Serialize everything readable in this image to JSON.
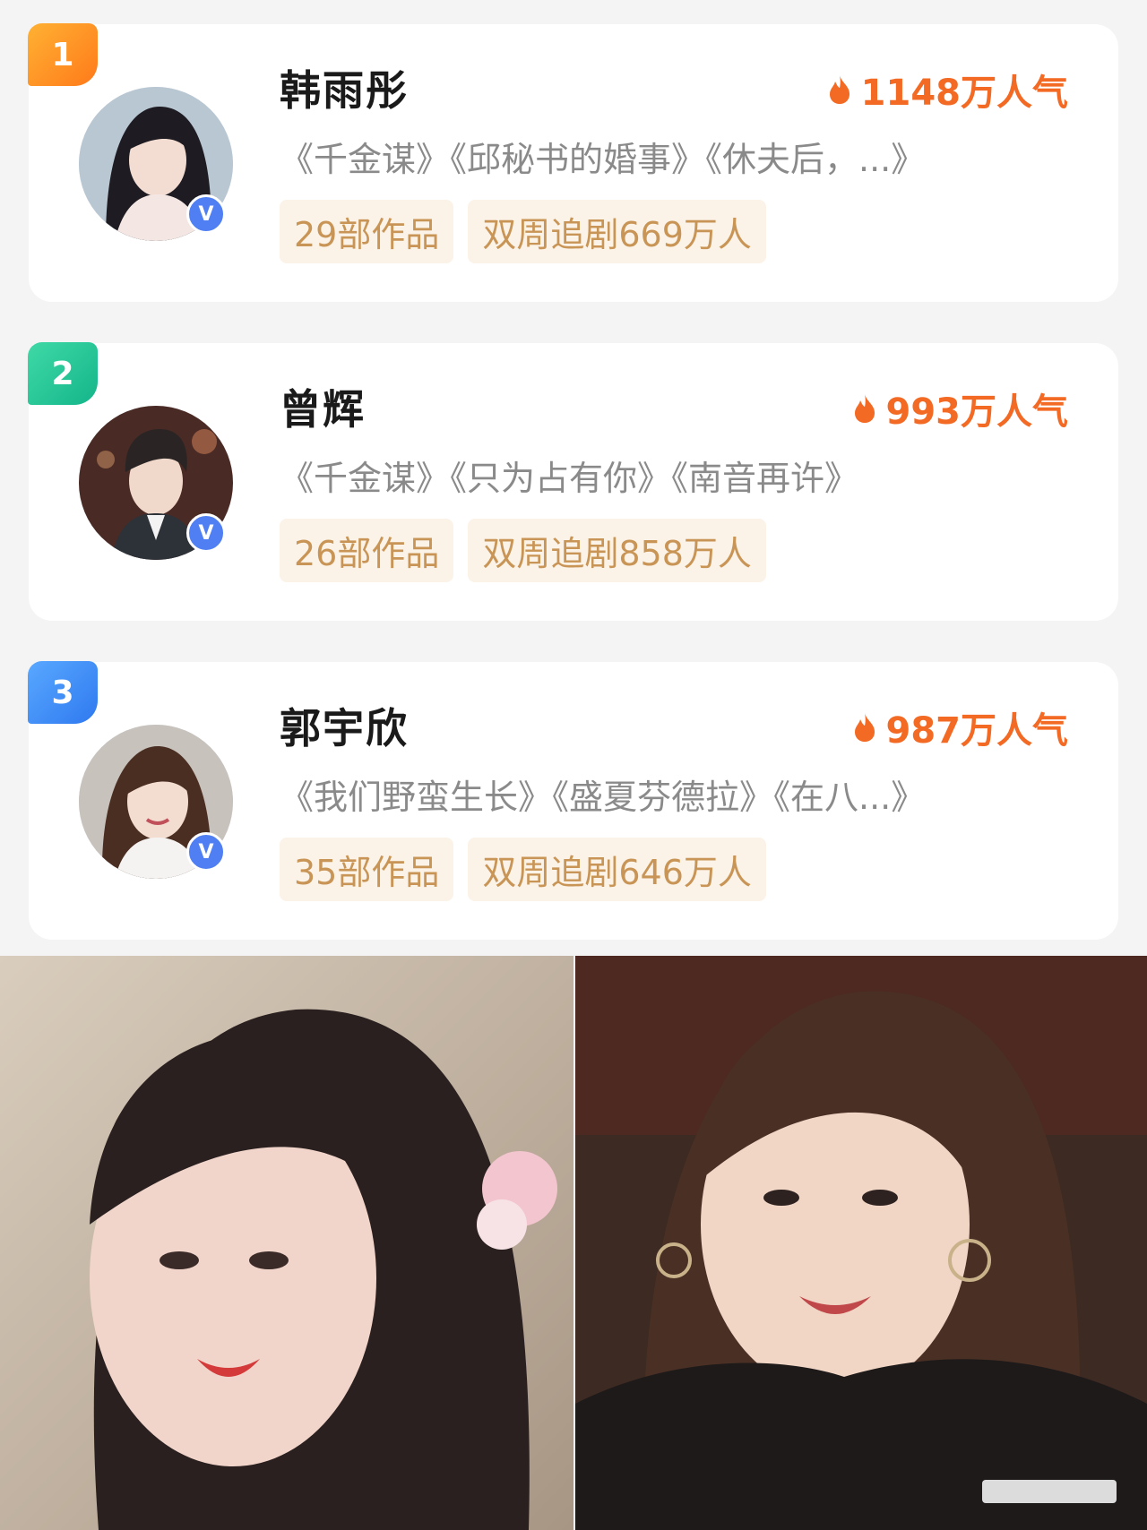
{
  "ranking": [
    {
      "rank": "1",
      "name": "韩雨彤",
      "popularity": "1148万人气",
      "works": "《千金谋》《邱秘书的婚事》《休夫后，...》",
      "works_count": "29部作品",
      "followers": "双周追剧669万人",
      "verified_badge": "V"
    },
    {
      "rank": "2",
      "name": "曾辉",
      "popularity": "993万人气",
      "works": "《千金谋》《只为占有你》《南音再许》",
      "works_count": "26部作品",
      "followers": "双周追剧858万人",
      "verified_badge": "V"
    },
    {
      "rank": "3",
      "name": "郭宇欣",
      "popularity": "987万人气",
      "works": "《我们野蛮生长》《盛夏芬德拉》《在八...》",
      "works_count": "35部作品",
      "followers": "双周追剧646万人",
      "verified_badge": "V"
    }
  ],
  "colors": {
    "rank_1": "#ff8a1f",
    "rank_2": "#1bbf90",
    "rank_3": "#3585f5",
    "popularity": "#f36a25",
    "tag_text": "#c99556",
    "tag_bg": "#fbf3e8",
    "verify_badge": "#4f7ff2"
  }
}
